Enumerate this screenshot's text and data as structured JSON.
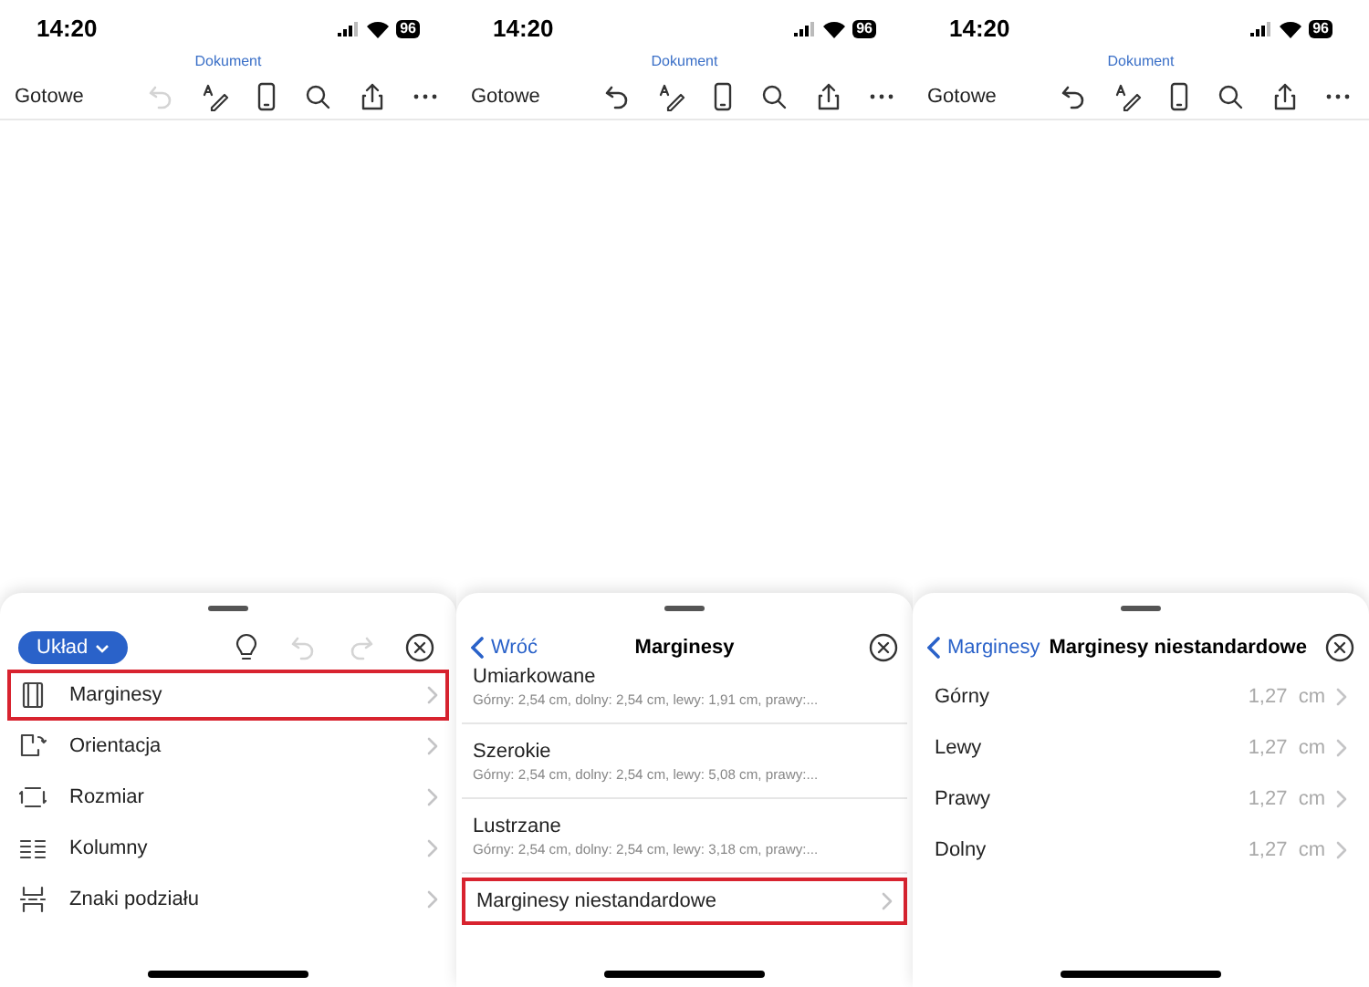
{
  "screens": [
    {
      "status_bar": {
        "time": "14:20",
        "battery": "96"
      },
      "toolbar": {
        "title": "Dokument",
        "done": "Gotowe",
        "undo_disabled": true
      },
      "sheet": {
        "kind": "ribbon",
        "tab_button": "Układ",
        "undo_disabled": true,
        "redo_disabled": true,
        "items": [
          {
            "label": "Marginesy",
            "highlighted": true
          },
          {
            "label": "Orientacja",
            "highlighted": false
          },
          {
            "label": "Rozmiar",
            "highlighted": false
          },
          {
            "label": "Kolumny",
            "highlighted": false
          },
          {
            "label": "Znaki podziału",
            "highlighted": false
          }
        ]
      }
    },
    {
      "status_bar": {
        "time": "14:20",
        "battery": "96"
      },
      "toolbar": {
        "title": "Dokument",
        "done": "Gotowe",
        "undo_disabled": false
      },
      "sheet": {
        "kind": "list",
        "back": "Wróć",
        "title": "Marginesy",
        "items": [
          {
            "label": "Umiarkowane",
            "detail": "Górny: 2,54  cm, dolny: 2,54  cm, lewy: 1,91  cm, prawy:...",
            "highlighted": false
          },
          {
            "label": "Szerokie",
            "detail": "Górny: 2,54  cm, dolny: 2,54  cm, lewy: 5,08  cm, prawy:...",
            "highlighted": false
          },
          {
            "label": "Lustrzane",
            "detail": "Górny: 2,54  cm, dolny: 2,54  cm, lewy: 3,18  cm, prawy:...",
            "highlighted": false
          },
          {
            "label": "Marginesy niestandardowe",
            "highlighted": true
          }
        ]
      }
    },
    {
      "status_bar": {
        "time": "14:20",
        "battery": "96"
      },
      "toolbar": {
        "title": "Dokument",
        "done": "Gotowe",
        "undo_disabled": false
      },
      "sheet": {
        "kind": "values",
        "back": "Marginesy",
        "title": "Marginesy niestandardowe",
        "items": [
          {
            "label": "Górny",
            "value": "1,27  cm"
          },
          {
            "label": "Lewy",
            "value": "1,27  cm"
          },
          {
            "label": "Prawy",
            "value": "1,27  cm"
          },
          {
            "label": "Dolny",
            "value": "1,27  cm"
          }
        ]
      }
    }
  ]
}
